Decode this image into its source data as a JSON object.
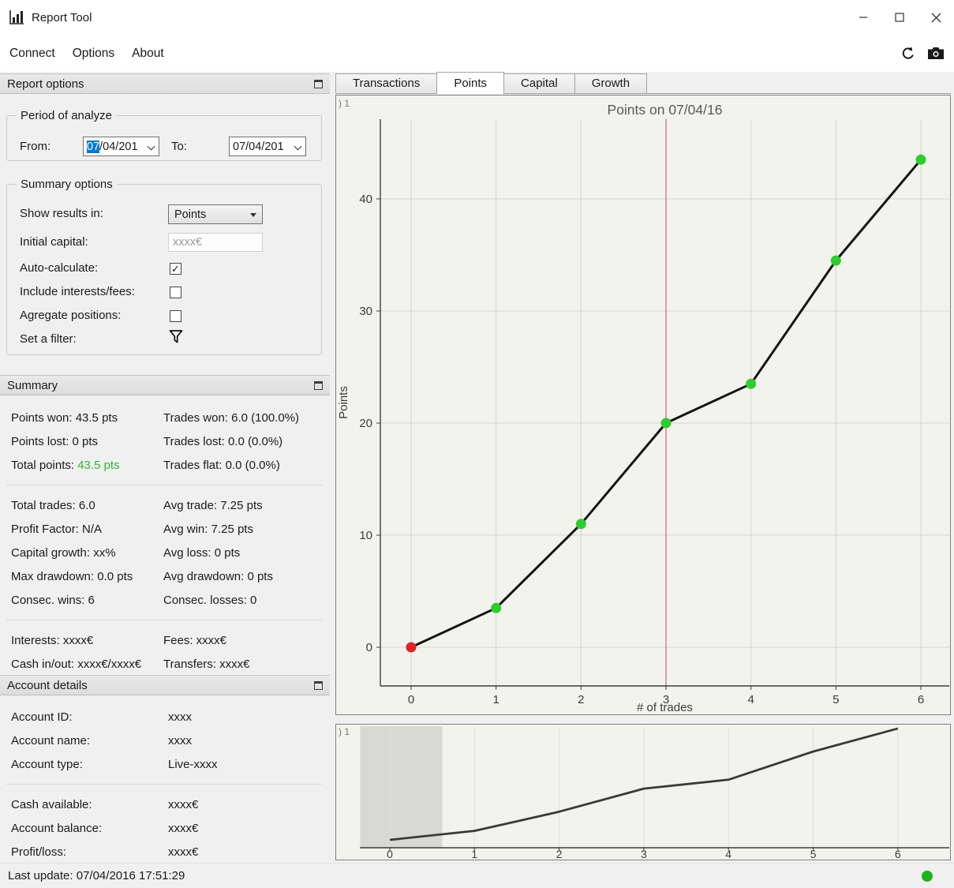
{
  "window": {
    "title": "Report Tool"
  },
  "menubar": {
    "items": [
      "Connect",
      "Options",
      "About"
    ]
  },
  "report_options": {
    "header": "Report options",
    "period": {
      "legend": "Period of analyze",
      "from_label": "From:",
      "from_value_selected": "07",
      "from_value_rest": "/04/201",
      "to_label": "To:",
      "to_value": "07/04/201"
    },
    "summary_options": {
      "legend": "Summary options",
      "show_results_label": "Show results in:",
      "show_results_value": "Points",
      "initial_capital_label": "Initial capital:",
      "initial_capital_placeholder": "xxxx€",
      "auto_calculate_label": "Auto-calculate:",
      "auto_calculate_checked": true,
      "include_interests_label": "Include interests/fees:",
      "include_interests_checked": false,
      "aggregate_positions_label": "Agregate positions:",
      "aggregate_positions_checked": false,
      "set_filter_label": "Set a filter:"
    }
  },
  "summary": {
    "header": "Summary",
    "groups": [
      [
        [
          {
            "text": "Points won: 43.5 pts"
          },
          {
            "text": "Trades won: 6.0 (100.0%)"
          }
        ],
        [
          {
            "text": "Points lost: 0 pts"
          },
          {
            "text": "Trades lost: 0.0 (0.0%)"
          }
        ],
        [
          {
            "label": "Total points:",
            "value": "43.5 pts",
            "value_color": "#2db82d"
          },
          {
            "text": "Trades flat: 0.0 (0.0%)"
          }
        ]
      ],
      [
        [
          {
            "text": "Total trades: 6.0"
          },
          {
            "text": "Avg trade: 7.25 pts"
          }
        ],
        [
          {
            "text": "Profit Factor: N/A"
          },
          {
            "text": "Avg win: 7.25 pts"
          }
        ],
        [
          {
            "text": "Capital growth: xx%"
          },
          {
            "text": "Avg loss: 0 pts"
          }
        ],
        [
          {
            "text": "Max drawdown: 0.0 pts"
          },
          {
            "text": "Avg drawdown: 0 pts"
          }
        ],
        [
          {
            "text": "Consec. wins: 6"
          },
          {
            "text": "Consec. losses: 0"
          }
        ]
      ],
      [
        [
          {
            "text": "Interests: xxxx€"
          },
          {
            "text": "Fees: xxxx€"
          }
        ],
        [
          {
            "text": "Cash in/out: xxxx€/xxxx€"
          },
          {
            "text": "Transfers: xxxx€"
          }
        ]
      ]
    ]
  },
  "account_details": {
    "header": "Account details",
    "groups": [
      [
        [
          "Account ID:",
          "xxxx"
        ],
        [
          "Account name:",
          "xxxx"
        ],
        [
          "Account type:",
          "Live-xxxx"
        ]
      ],
      [
        [
          "Cash available:",
          "xxxx€"
        ],
        [
          "Account balance:",
          "xxxx€"
        ],
        [
          "Profit/loss:",
          "xxxx€"
        ]
      ]
    ]
  },
  "statusbar": {
    "text": "Last update: 07/04/2016 17:51:29",
    "connection_color": "#1db31d"
  },
  "tabs": [
    {
      "label": "Transactions",
      "active": false
    },
    {
      "label": "Points",
      "active": true
    },
    {
      "label": "Capital",
      "active": false
    },
    {
      "label": "Growth",
      "active": false
    }
  ],
  "chart_data": {
    "type": "line",
    "title": "Points on 07/04/16",
    "xlabel": "# of trades",
    "ylabel": "Points",
    "x": [
      0,
      1,
      2,
      3,
      4,
      5,
      6
    ],
    "y": [
      0,
      3.5,
      11,
      20,
      23.5,
      34.5,
      43.5
    ],
    "xticks": [
      0,
      1,
      2,
      3,
      4,
      5,
      6
    ],
    "yticks": [
      0,
      10,
      20,
      30,
      40
    ],
    "xlim": [
      -0.36,
      6.34
    ],
    "ylim": [
      -3.4,
      47.1
    ],
    "grid": true,
    "legend": "none",
    "line_color": "#141414",
    "marker_colors": [
      "#e02424",
      "#2ecc2e",
      "#2ecc2e",
      "#2ecc2e",
      "#2ecc2e",
      "#2ecc2e",
      "#2ecc2e"
    ],
    "vline": {
      "x": 3,
      "color": "#c46a6a"
    },
    "corner_label": ") 1",
    "navigator": {
      "x": [
        0,
        1,
        2,
        3,
        4,
        5,
        6
      ],
      "y": [
        0,
        3.5,
        11,
        20,
        23.5,
        34.5,
        43.5
      ],
      "xticks": [
        0,
        1,
        2,
        3,
        4,
        5,
        6
      ],
      "line_color": "#3a3a3a",
      "selection_band": [
        -0.35,
        0.62
      ],
      "corner_label": ") 1"
    }
  }
}
